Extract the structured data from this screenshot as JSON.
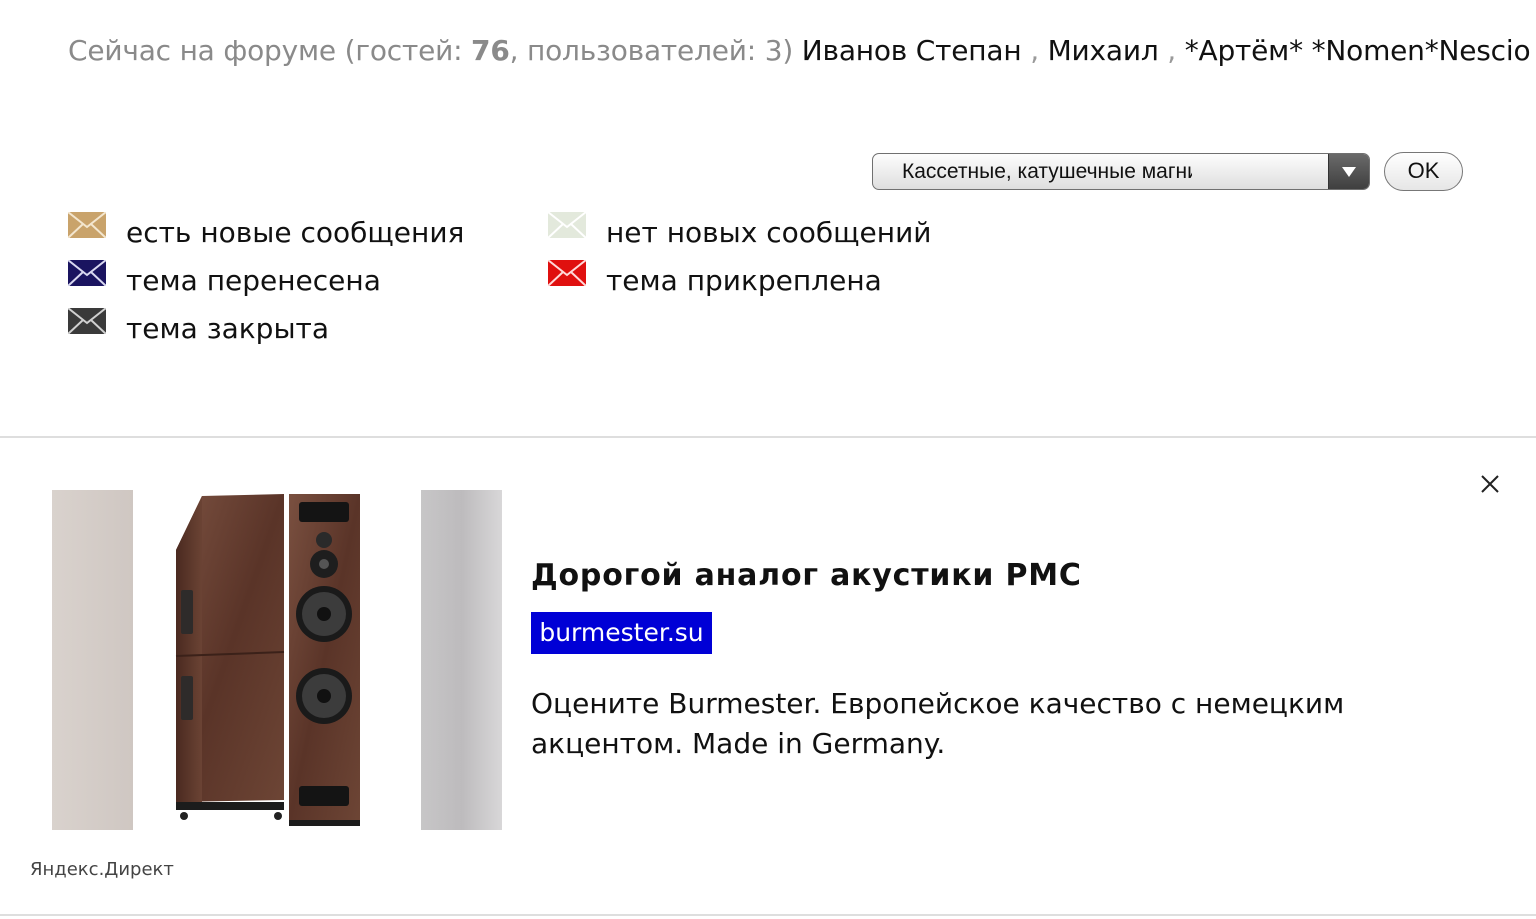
{
  "online": {
    "prefix": "Сейчас на форуме (гостей: ",
    "guests": "76",
    "middle": ", пользователей: 3)",
    "users": [
      "Иванов Степан",
      "Михаил",
      "*Артём*",
      "*Nomen*Nescio"
    ],
    "separator": ","
  },
  "forum_jump": {
    "selected": "Кассетные, катушечные магнитофоны (а",
    "ok_label": "OK"
  },
  "legend": {
    "new_messages": "есть новые сообщения",
    "no_new_messages": "нет новых сообщений",
    "moved": "тема перенесена",
    "pinned": "тема прикреплена",
    "closed": "тема закрыта"
  },
  "icon_colors": {
    "new": "#c9a36b",
    "none": "#e3e9dc",
    "moved": "#1a1460",
    "pinned": "#e0100f",
    "closed": "#3a3a3a"
  },
  "ad": {
    "title": "Дорогой аналог акустики PMC",
    "domain": "burmester.su",
    "text": "Оцените Burmester. Европейское качество с немецким акцентом. Made in Germany.",
    "source": "Яндекс.Директ",
    "domain_color": "#0000d6"
  }
}
